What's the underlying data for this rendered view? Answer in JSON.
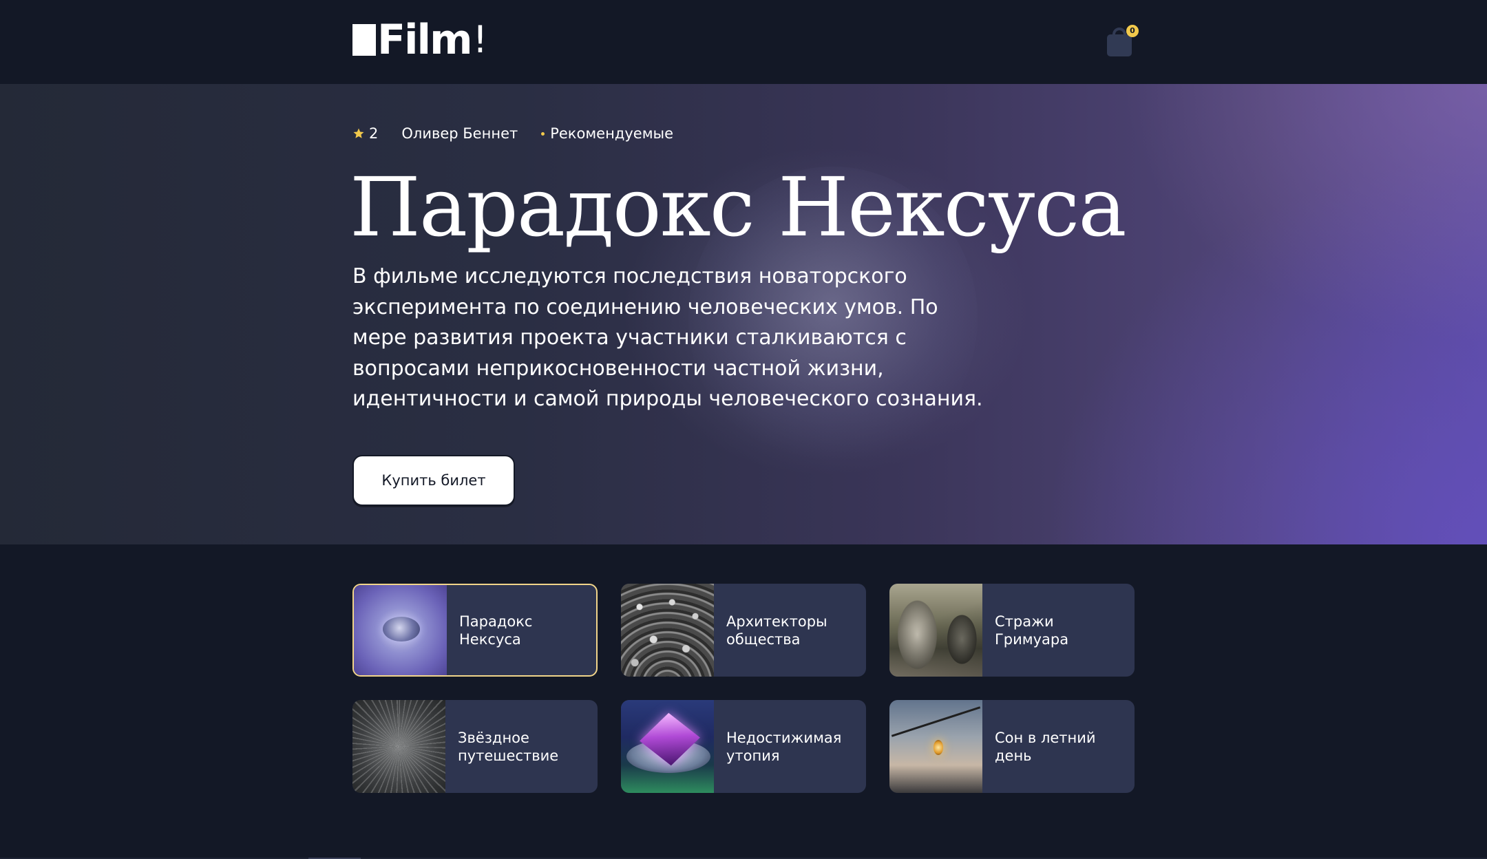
{
  "header": {
    "logo_text": "Film",
    "logo_bang": "!",
    "cart_count": "0"
  },
  "hero": {
    "rating": "2",
    "author": "Оливер Беннет",
    "tag": "Рекомендуемые",
    "title": "Парадокс Нексуса",
    "description": "В фильме исследуются последствия новаторского эксперимента по соединению человеческих умов. По мере развития проекта участники сталкиваются с вопросами неприкосновенности частной жизни, идентичности и самой природы человеческого сознания.",
    "buy_label": "Купить билет"
  },
  "films": [
    {
      "title": "Парадокс Нексуса",
      "active": true
    },
    {
      "title": "Архитекторы общества",
      "active": false
    },
    {
      "title": "Стражи Гримуара",
      "active": false
    },
    {
      "title": "Звёздное путешествие",
      "active": false
    },
    {
      "title": "Недостижимая утопия",
      "active": false
    },
    {
      "title": "Сон в летний день",
      "active": false
    }
  ],
  "colors": {
    "background": "#131826",
    "card": "#2e3550",
    "accent_gold": "#f2c94c",
    "active_border": "#f2d58a"
  }
}
